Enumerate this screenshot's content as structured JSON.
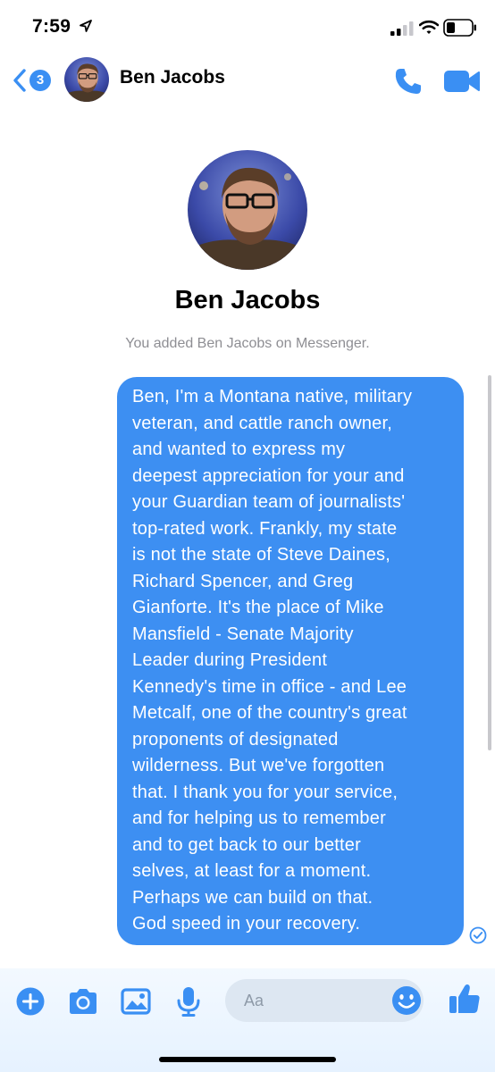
{
  "status_bar": {
    "time": "7:59"
  },
  "header": {
    "unread_count": "3",
    "contact_name": "Ben Jacobs",
    "icons": [
      "back-chevron-icon",
      "phone-icon",
      "video-camera-icon"
    ]
  },
  "profile": {
    "name": "Ben Jacobs",
    "added_note": "You added Ben Jacobs on Messenger."
  },
  "message": {
    "direction": "outgoing",
    "status": "sent",
    "lines": [
      "Ben, I'm a Montana native, military",
      "veteran, and cattle ranch owner,",
      "and wanted to express my",
      "deepest appreciation for your and",
      "your Guardian team of journalists'",
      "top-rated work.  Frankly, my state",
      "is not the state of Steve Daines,",
      "Richard Spencer, and Greg",
      "Gianforte.  It's the place of Mike",
      "Mansfield - Senate Majority",
      "Leader during President",
      "Kennedy's time in office - and Lee",
      "Metcalf, one of the country's great",
      "proponents of designated",
      "wilderness.  But we've forgotten",
      "that.  I thank you for your service,",
      "and for helping us to remember",
      "and to get back to our better",
      "selves, at least for a moment.",
      "Perhaps we can build on that.",
      "God speed in your recovery."
    ]
  },
  "composer": {
    "placeholder": "Aa",
    "icons": [
      "plus-icon",
      "camera-icon",
      "gallery-icon",
      "microphone-icon",
      "emoji-icon",
      "thumbs-up-icon"
    ]
  },
  "colors": {
    "accent": "#3a8ff3",
    "bubble": "#3d8ff2",
    "muted_text": "#8e8e93"
  }
}
